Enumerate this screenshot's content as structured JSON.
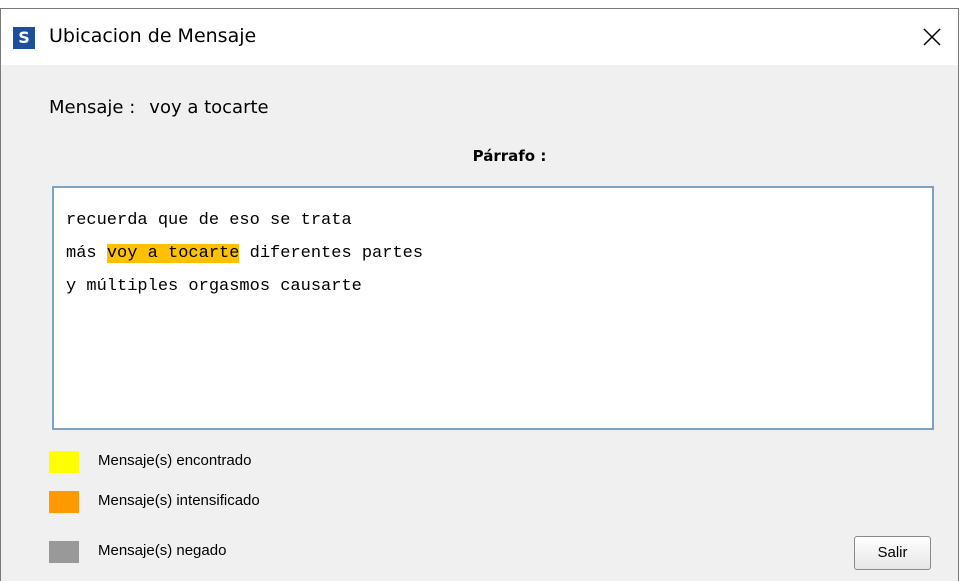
{
  "window": {
    "app_icon_letter": "S",
    "title": "Ubicacion de Mensaje"
  },
  "message": {
    "label": "Mensaje :",
    "value": "voy a tocarte"
  },
  "paragraph": {
    "heading": "Párrafo :",
    "lines": [
      {
        "before": "recuerda que de eso se trata",
        "highlight": "",
        "after": ""
      },
      {
        "before": "más ",
        "highlight": "voy a tocarte",
        "after": " diferentes partes"
      },
      {
        "before": "y múltiples orgasmos causarte",
        "highlight": "",
        "after": ""
      }
    ],
    "highlight_color": "#ffc000"
  },
  "legend": [
    {
      "label": "Mensaje(s) encontrado",
      "color": "#ffff00"
    },
    {
      "label": "Mensaje(s) intensificado",
      "color": "#ff9900"
    },
    {
      "label": "Mensaje(s) negado",
      "color": "#999999"
    }
  ],
  "buttons": {
    "exit_label": "Salir"
  }
}
